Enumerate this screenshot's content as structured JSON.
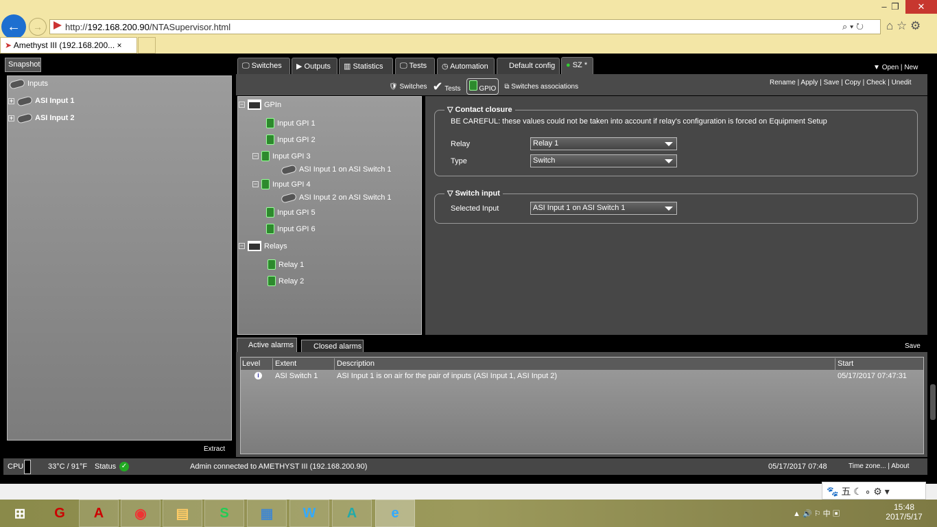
{
  "browser": {
    "url_prefix": "http://",
    "url_host": "192.168.200.90",
    "url_path": "/NTASupervisor.html",
    "tab_title": "Amethyst III (192.168.200...",
    "tab_close": "×"
  },
  "left": {
    "tab": "Snapshot",
    "root": "Inputs",
    "items": [
      "ASI Input 1",
      "ASI Input 2"
    ],
    "extract": "Extract"
  },
  "main_tabs": [
    "Switches",
    "Outputs",
    "Statistics",
    "Tests",
    "Automation",
    "Default config",
    "SZ *"
  ],
  "open_new": {
    "open": "Open",
    "new": "New"
  },
  "sub_tabs": [
    "Switches",
    "Tests",
    "GPIO",
    "Switches associations"
  ],
  "actions": [
    "Rename",
    "Apply",
    "Save",
    "Copy",
    "Check",
    "Unedit"
  ],
  "tree": {
    "gpin": "GPIn",
    "inputs": [
      "Input GPI 1",
      "Input GPI 2",
      "Input GPI 3",
      "ASI Input 1 on ASI Switch 1",
      "Input GPI 4",
      "ASI Input 2 on ASI Switch 1",
      "Input GPI 5",
      "Input GPI 6"
    ],
    "relays": "Relays",
    "relay_items": [
      "Relay 1",
      "Relay 2"
    ]
  },
  "contact": {
    "title": "Contact closure",
    "warning": "BE CAREFUL: these values could not be taken into account if relay's configuration is forced on Equipment Setup",
    "relay_label": "Relay",
    "relay_value": "Relay 1",
    "type_label": "Type",
    "type_value": "Switch"
  },
  "switch_input": {
    "title": "Switch input",
    "label": "Selected Input",
    "value": "ASI Input 1 on ASI Switch 1"
  },
  "alarms": {
    "tabs": [
      "Active alarms",
      "Closed alarms"
    ],
    "save": "Save",
    "columns": [
      "Level",
      "Extent",
      "Description",
      "Start"
    ],
    "rows": [
      {
        "level": "info",
        "extent": "ASI Switch 1",
        "description": "ASI Input 1 is on air for the pair of inputs (ASI Input 1, ASI Input 2)",
        "start": "05/17/2017 07:47:31"
      }
    ]
  },
  "status": {
    "cpu": "CPU",
    "temp": "33°C / 91°F",
    "status": "Status",
    "connected": "Admin connected to AMETHYST III (192.168.200.90)",
    "datetime": "05/17/2017 07:48",
    "timezone": "Time zone...",
    "about": "About"
  },
  "taskbar": {
    "time": "15:48",
    "date": "2017/5/17",
    "ime": "中",
    "ime2": "五"
  }
}
